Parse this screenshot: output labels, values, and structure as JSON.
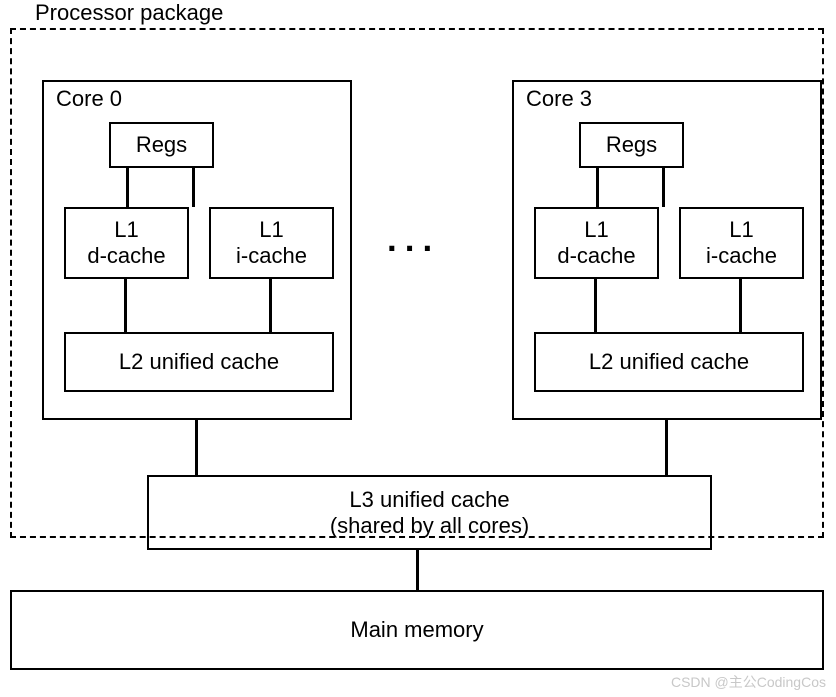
{
  "labels": {
    "package": "Processor package",
    "core0": "Core 0",
    "core3": "Core 3",
    "regs": "Regs",
    "l1d_line1": "L1",
    "l1d_line2": "d-cache",
    "l1i_line1": "L1",
    "l1i_line2": "i-cache",
    "l2": "L2 unified cache",
    "l3_line1": "L3 unified cache",
    "l3_line2": "(shared by all cores)",
    "mainmem": "Main memory",
    "dots": "...",
    "watermark": "CSDN @主公CodingCos"
  }
}
